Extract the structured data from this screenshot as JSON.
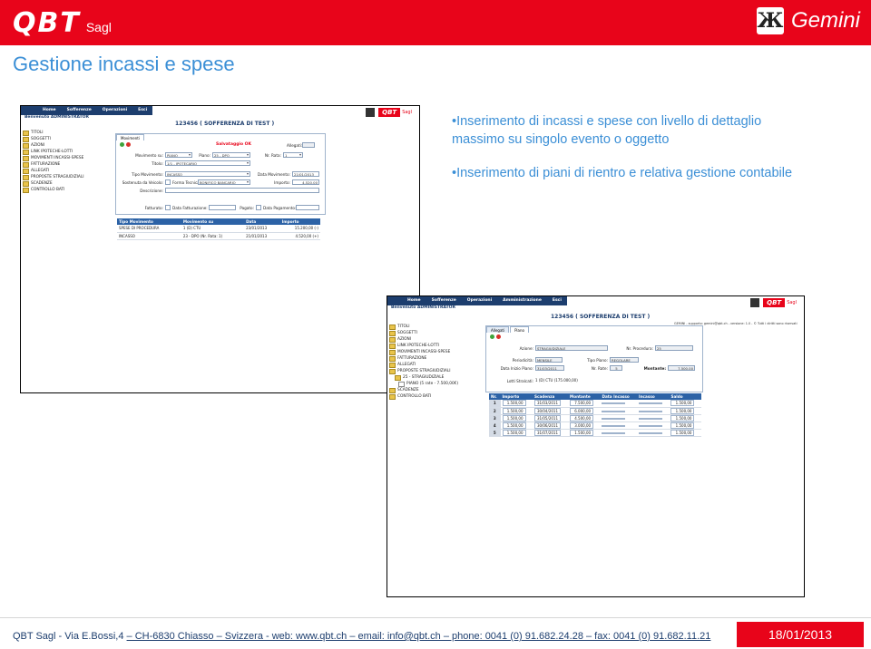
{
  "header": {
    "logo_text": "QBT",
    "logo_suffix": "Sagl",
    "product_glyph": "Ж",
    "product_name": "Gemini",
    "colors": {
      "brand_red": "#e8041a",
      "title_blue": "#3b8fd6",
      "app_navy": "#1d3e6e",
      "grid_header": "#2c62a6"
    }
  },
  "slide_title": "Gestione incassi e spese",
  "bullets": [
    "•Inserimento di incassi e spese con livello di dettaglio massimo su singolo evento o oggetto",
    "•Inserimento di piani di rientro e relativa gestione contabile"
  ],
  "screenshot1": {
    "menu": [
      "Home",
      "Sofferenze",
      "Operazioni",
      "Esci"
    ],
    "welcome": "Benvenuto ADMINISTRATOR",
    "record_title": "123456  ( SOFFERENZA DI TEST )",
    "brand": "QBT",
    "brand_suffix": "Sagl",
    "tree": [
      "TITOLI",
      "SOGGETTI",
      "AZIONI",
      "LINK IPOTECHE-LOTTI",
      "MOVIMENTI INCASSI-SPESE",
      "FATTURAZIONE",
      "ALLEGATI",
      "PROPOSTE STRAGIUDIZIALI",
      "SCADENZE",
      "CONTROLLO BATI"
    ],
    "tab": "Movimenti",
    "status": "Salvataggio OK",
    "form": {
      "allegati_label": "Allegati:",
      "movimento_label": "Movimento su:",
      "movimento_value": "PIANO",
      "piano_label": "Piano:",
      "piano_value": "25 - DPO",
      "rata_label": "Nr. Rata:",
      "rata_value": "1",
      "titolo_label": "Titolo:",
      "titolo_value": "1/1 - IPOTECARIO",
      "tipo_label": "Tipo Movimento:",
      "tipo_value": "INCASSO",
      "data_mov_label": "Data Movimento:",
      "data_mov_value": "21/01/2013",
      "sostenuta_label": "Sostenuta da Veicolo:",
      "forma_label": "Forma Tecnica:",
      "forma_value": "BONIFICO BANCARIO",
      "importo_label": "Importo:",
      "importo_value": "4.520,00",
      "descrizione_label": "Descrizione:",
      "fatturato_label": "Fatturato:",
      "data_fatt_label": "Data Fatturazione:",
      "pagato_label": "Pagato:",
      "data_pag_label": "Data Pagamento:"
    },
    "table": {
      "headers": [
        "Tipo Movimento",
        "Movimento su",
        "Data",
        "Importo"
      ],
      "rows": [
        [
          "SPESE DI PROCEDURA",
          "1 (D) CTU",
          "23/01/2013",
          "15.200,00 (-)"
        ],
        [
          "INCASSO",
          "23 - DPO (Nr. Rata: 1)",
          "21/01/2013",
          "4.520,00 (+)"
        ]
      ]
    }
  },
  "screenshot2": {
    "menu": [
      "Home",
      "Sofferenze",
      "Operazioni",
      "Amministrazione",
      "Esci"
    ],
    "welcome": "Benvenuto ADMINISTRATOR",
    "record_title": "123456  ( SOFFERENZA DI TEST )",
    "brand": "QBT",
    "brand_suffix": "Sagl",
    "support_text": "GEMINI - supporto: gemini@qbt.ch - versione: 1.0 - © Tutti i diritti sono riservati",
    "tree": [
      "TITOLI",
      "SOGGETTI",
      "AZIONI",
      "LINK IPOTECHE-LOTTI",
      "MOVIMENTI INCASSI-SPESE",
      "FATTURAZIONE",
      "ALLEGATI",
      "PROPOSTE STRAGIUDIZIALI"
    ],
    "tree_sub": "25 - STRAGIUDIZIALE",
    "tree_sub2": "PIANO (5 rate - 7.500,00€)",
    "tree_after": [
      "SCADENZE",
      "CONTROLLO BATI"
    ],
    "tabs": [
      "Allegati",
      "Piano"
    ],
    "form": {
      "azione_label": "Azione:",
      "azione_value": "STRAGIUDIZIALE",
      "procedura_label": "Nr. Procedura:",
      "procedura_value": "25",
      "periodicita_label": "Periodicità:",
      "periodicita_value": "MENSILE",
      "tipo_piano_label": "Tipo Piano:",
      "tipo_piano_value": "REGOLARE",
      "data_inizio_label": "Data Inizio Piano:",
      "data_inizio_value": "31/03/2011",
      "nr_rate_label": "Nr. Rate:",
      "nr_rate_value": "5",
      "montante_label": "Montante:",
      "montante_value": "7.500,00",
      "lotti_label": "Lotti Stralcati:",
      "lotti_value": "1 (D) CTU (175.000,00)"
    },
    "table": {
      "headers": [
        "Nr.",
        "Importo",
        "Scadenza",
        "Montante",
        "Data Incasso",
        "Incasso",
        "Saldo"
      ],
      "rows": [
        [
          "1",
          "1.500,00",
          "31/03/2011",
          "7.500,00",
          "",
          "",
          "1.500,00"
        ],
        [
          "2",
          "1.500,00",
          "30/04/2011",
          "6.000,00",
          "",
          "",
          "1.500,00"
        ],
        [
          "3",
          "1.500,00",
          "31/05/2011",
          "4.500,00",
          "",
          "",
          "1.500,00"
        ],
        [
          "4",
          "1.500,00",
          "30/06/2011",
          "3.000,00",
          "",
          "",
          "1.500,00"
        ],
        [
          "5",
          "1.500,00",
          "31/07/2011",
          "1.500,00",
          "",
          "",
          "1.500,00"
        ]
      ]
    }
  },
  "footer": {
    "company": "QBT Sagl  - Via E.Bossi,4 ",
    "address": "– CH-6830 Chiasso – Svizzera - web: www.qbt.ch – email: info@qbt.ch – phone: 0041 (0) 91.682.24.28 – fax: 0041 (0) 91.682.11.21",
    "date": "18/01/2013"
  }
}
